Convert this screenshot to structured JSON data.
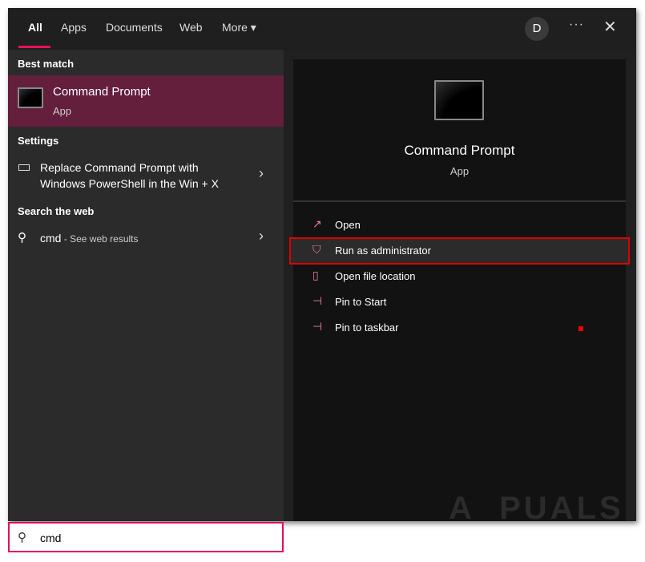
{
  "tabs": [
    {
      "label": "All"
    },
    {
      "label": "Apps"
    },
    {
      "label": "Documents"
    },
    {
      "label": "Web"
    },
    {
      "label": "More ▾"
    }
  ],
  "header": {
    "avatar": "D",
    "more_options": "···",
    "close": "✕"
  },
  "left": {
    "best_match_heading": "Best match",
    "best_match": {
      "title": "Command Prompt",
      "subtitle": "App"
    },
    "settings_heading": "Settings",
    "settings_item": {
      "line1": "Replace Command Prompt with",
      "line2": "Windows PowerShell in the Win + X"
    },
    "web_heading": "Search the web",
    "web_item": {
      "query": "cmd",
      "suffix": " - See web results"
    }
  },
  "right": {
    "title": "Command Prompt",
    "subtitle": "App",
    "actions": [
      {
        "label": "Open"
      },
      {
        "label": "Run as administrator"
      },
      {
        "label": "Open file location"
      },
      {
        "label": "Pin to Start"
      },
      {
        "label": "Pin to taskbar"
      }
    ]
  },
  "search": {
    "value": "cmd"
  },
  "watermark": "APPUALS",
  "colors": {
    "accent": "#e8125b",
    "selected": "#631f3c",
    "highlight": "#e00000"
  }
}
